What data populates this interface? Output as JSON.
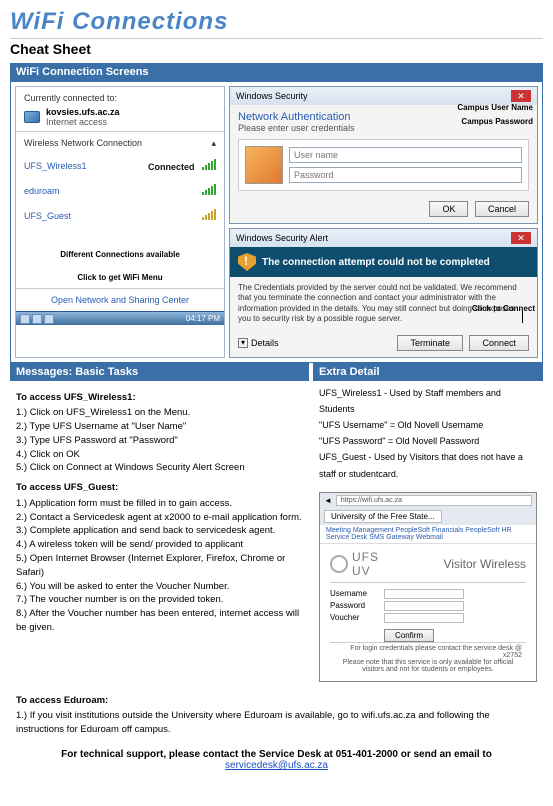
{
  "title": "WiFi Connections",
  "subtitle": "Cheat Sheet",
  "section_screens": "WiFi Connection Screens",
  "wifi_menu": {
    "currently": "Currently connected to:",
    "ssid": "kovsies.ufs.ac.za",
    "access": "Internet access",
    "wnc": "Wireless Network Connection",
    "nets": [
      {
        "name": "UFS_Wireless1",
        "status": "Connected"
      },
      {
        "name": "eduroam",
        "status": ""
      },
      {
        "name": "UFS_Guest",
        "status": ""
      }
    ],
    "caption1": "Different Connections available",
    "caption2": "Click to get WiFi Menu",
    "open_link": "Open Network and Sharing Center",
    "clock": "04:17 PM"
  },
  "sec_dialog": {
    "title": "Windows Security",
    "netauth": "Network Authentication",
    "prompt": "Please enter user credentials",
    "user_ph": "User name",
    "pass_ph": "Password",
    "ok": "OK",
    "cancel": "Cancel",
    "callout_user": "Campus User Name",
    "callout_pass": "Campus Password"
  },
  "alert_dialog": {
    "title": "Windows Security Alert",
    "banner": "The connection attempt could not be completed",
    "body": "The Credentials provided by the server could not be validated. We recommend that you terminate the connection and contact your administrator with the information provided in the details. You may still connect but doing so exposes you to security risk by a possible rogue server.",
    "details": "Details",
    "terminate": "Terminate",
    "connect": "Connect",
    "click_connect": "Click to Connect"
  },
  "messages_title": "Messages: Basic Tasks",
  "extra_title": "Extra Detail",
  "wireless1_hdr": "To access UFS_Wireless1:",
  "wireless1_steps": [
    "1.) Click on UFS_Wireless1 on the Menu.",
    "2.) Type UFS Username at \"User Name\"",
    "3.) Type UFS Password at \"Password\"",
    "4.) Click on OK",
    "5.) Click on Connect at Windows Security Alert Screen"
  ],
  "guest_hdr": "To access UFS_Guest:",
  "guest_steps": [
    "1.) Application form must be filled in to gain access.",
    "2.) Contact a Servicedesk agent at x2000 to e-mail application form.",
    "3.) Complete application and send back to servicedesk agent.",
    "4.) A wireless token will be send/ provided to applicant",
    "5.) Open Internet Browser (Internet Explorer, Firefox, Chrome or Safari)",
    "6.) You will be asked to enter the Voucher Number.",
    "7.) The voucher number is on the provided token.",
    "8.) After the Voucher number has been entered, internet access will be given."
  ],
  "eduroam_hdr": "To access Eduroam:",
  "eduroam_step": "1.) If you visit institutions outside the University where Eduroam is available, go to wifi.ufs.ac.za and following the instructions for Eduroam off campus.",
  "extra": [
    "UFS_Wireless1 - Used by Staff members and Students",
    "\"UFS Username\" = Old Novell Username",
    "\"UFS Password\" = Old Novell Password",
    "UFS_Guest - Used by Visitors that does not have a staff or studentcard."
  ],
  "browser": {
    "url": "https://wifi.ufs.ac.za",
    "tab": "University of the Free State...",
    "links": "Meeting Management    PeopleSoft Financials    PeopleSoft HR    Service Desk    SMS Gateway    Webmail",
    "logo1": "UFS",
    "logo2": "UV",
    "title": "Visitor Wireless",
    "user_lbl": "Username",
    "pass_lbl": "Password",
    "voucher_lbl": "Voucher",
    "confirm": "Confirm",
    "foot1": "For login credentials please contact the service desk @ x2752",
    "foot2": "Please note that this service is only available for official visitors and not for students or employees."
  },
  "footer_line": "For technical support, please contact the Service Desk at 051-401-2000 or send an email to",
  "footer_email": " servicedesk@ufs.ac.za"
}
